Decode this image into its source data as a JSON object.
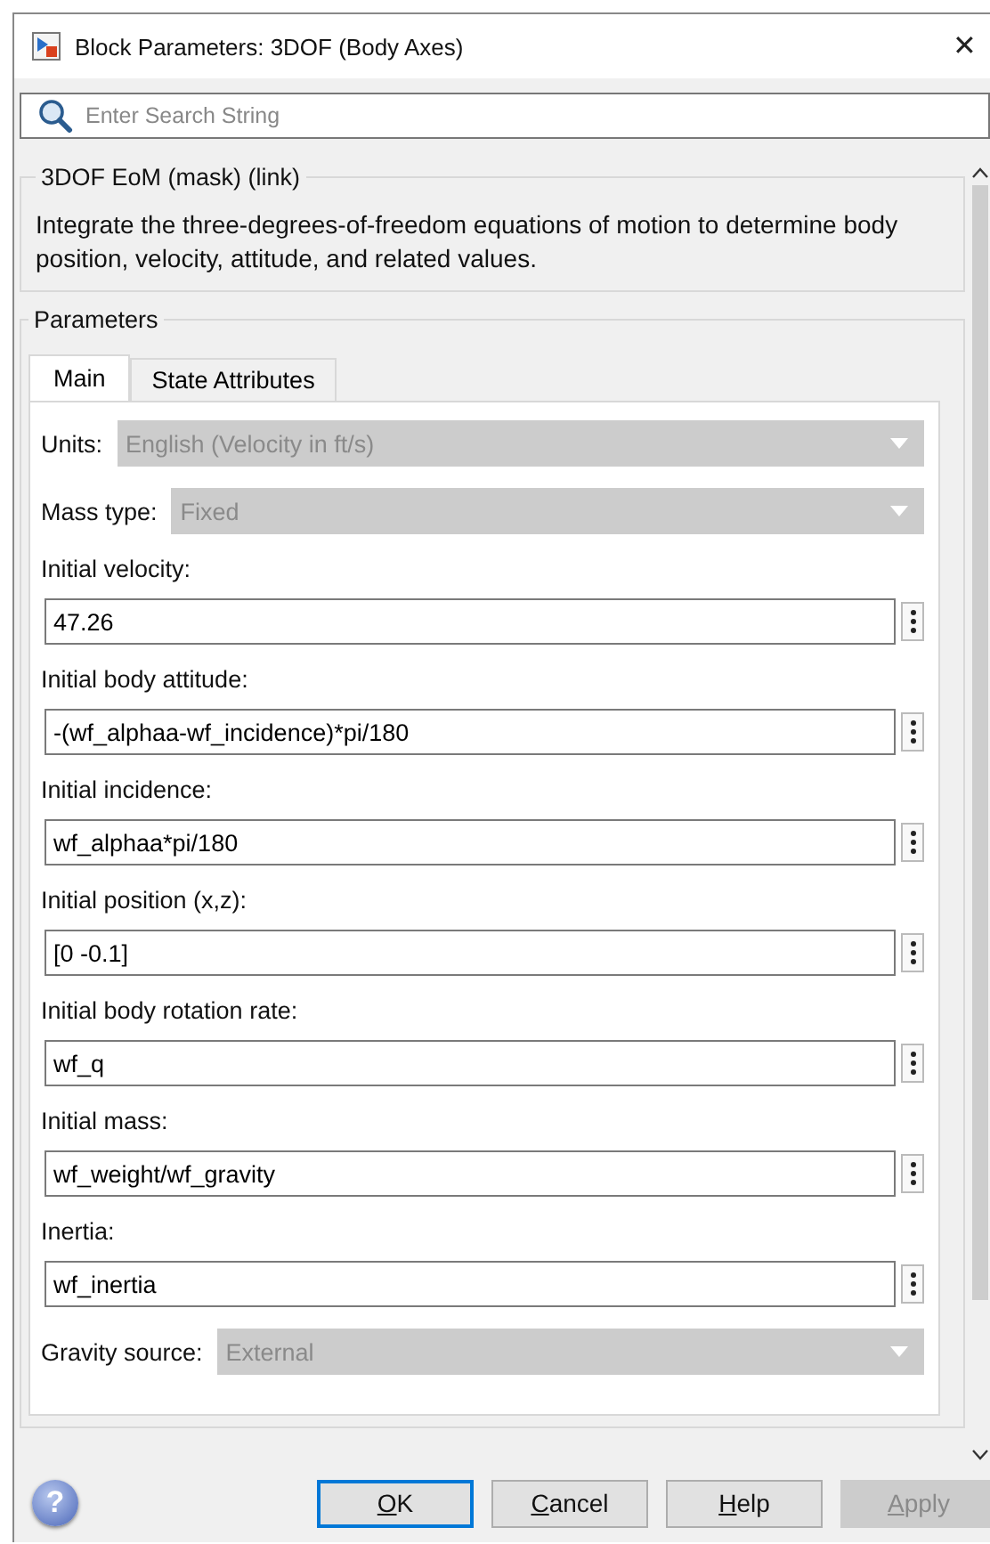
{
  "window": {
    "title": "Block Parameters: 3DOF (Body Axes)",
    "close": "✕"
  },
  "search": {
    "placeholder": "Enter Search String"
  },
  "description": {
    "title": "3DOF EoM (mask) (link)",
    "text": "Integrate the three-degrees-of-freedom equations of motion to determine body position, velocity, attitude, and related values."
  },
  "parameters": {
    "title": "Parameters",
    "tabs": [
      {
        "label": "Main",
        "selected": true
      },
      {
        "label": "State Attributes",
        "selected": false
      }
    ],
    "fields": [
      {
        "kind": "dropdown",
        "label": "Units:",
        "value": "English (Velocity in ft/s)",
        "disabled": true
      },
      {
        "kind": "dropdown",
        "label": "Mass type:",
        "value": "Fixed",
        "disabled": true
      },
      {
        "kind": "text",
        "label": "Initial velocity:",
        "value": "47.26"
      },
      {
        "kind": "text",
        "label": "Initial body attitude:",
        "value": "-(wf_alphaa-wf_incidence)*pi/180"
      },
      {
        "kind": "text",
        "label": "Initial incidence:",
        "value": "wf_alphaa*pi/180"
      },
      {
        "kind": "text",
        "label": "Initial position (x,z):",
        "value": "[0 -0.1]"
      },
      {
        "kind": "text",
        "label": "Initial body rotation rate:",
        "value": "wf_q"
      },
      {
        "kind": "text",
        "label": "Initial mass:",
        "value": "wf_weight/wf_gravity"
      },
      {
        "kind": "text",
        "label": "Inertia:",
        "value": "wf_inertia"
      },
      {
        "kind": "dropdown",
        "label": "Gravity source:",
        "value": "External",
        "disabled": true
      }
    ]
  },
  "help_icon": "?",
  "buttons": [
    {
      "label": "OK",
      "default": true,
      "disabled": false
    },
    {
      "label": "Cancel",
      "default": false,
      "disabled": false
    },
    {
      "label": "Help",
      "default": false,
      "disabled": false
    },
    {
      "label": "Apply",
      "default": false,
      "disabled": true
    }
  ]
}
